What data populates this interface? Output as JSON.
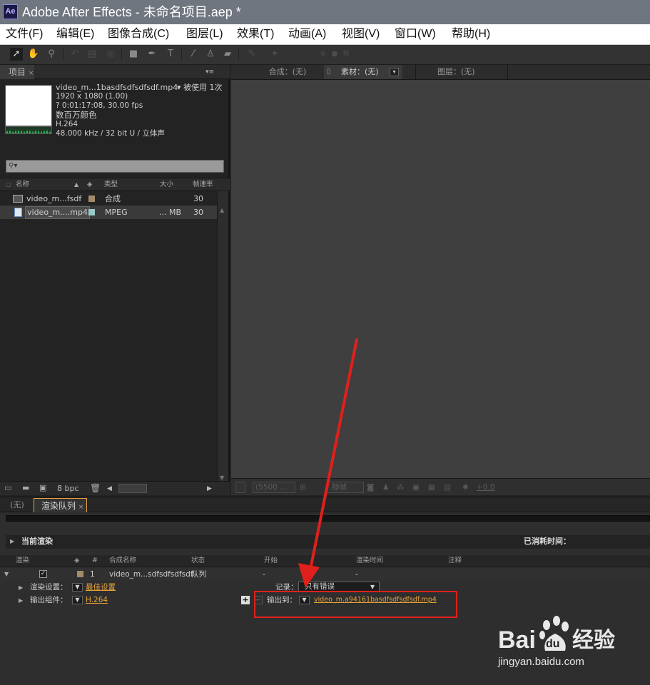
{
  "app": {
    "logo_text": "Ae",
    "title": "Adobe After Effects - 未命名项目.aep *"
  },
  "menu": [
    "文件(F)",
    "编辑(E)",
    "图像合成(C)",
    "图层(L)",
    "效果(T)",
    "动画(A)",
    "视图(V)",
    "窗口(W)",
    "帮助(H)"
  ],
  "toolbar": {
    "tools": [
      "selection-tool",
      "hand-tool",
      "zoom-tool",
      "rotate-tool",
      "camera-tool",
      "pan-behind-tool",
      "shape-tool",
      "pen-tool",
      "text-tool",
      "brush-tool",
      "clone-stamp-tool",
      "eraser-tool",
      "roto-brush-tool",
      "puppet-pin-tool"
    ]
  },
  "project": {
    "tab_label": "项目",
    "tab_close": "×",
    "menu_glyph": "▾≡",
    "asset": {
      "name": "video_m...1basdfsdfsdfsdf.mp4",
      "used": "▾  被使用 1次",
      "resolution": "1920 x 1080 (1.00)",
      "duration": "? 0:01:17:08, 30.00 fps",
      "color": "数百万颜色",
      "codec": "H.264",
      "audio": "48.000 kHz / 32 bit U / 立体声"
    },
    "search_icon": "⚲▾",
    "columns": {
      "name": "名称",
      "type": "类型",
      "size": "大小",
      "framerate": "帧速率"
    },
    "items": [
      {
        "name": "video_m...fsdf",
        "type": "合成",
        "size": "",
        "fps": "30",
        "swatch": "#a38a6a"
      },
      {
        "name": "video_m....mp4",
        "type": "MPEG",
        "size": "... MB",
        "fps": "30",
        "swatch": "#99c8c8"
      }
    ],
    "footer": {
      "bpc": "8 bpc"
    }
  },
  "viewer": {
    "tabs": {
      "comp": "合成：(无)",
      "footage": "素材：(无)",
      "layer": "图层：(无)"
    },
    "footer": {
      "zoom": "(5500 ...",
      "still": "静帧",
      "exposure": "+0.0"
    },
    "background": "#3f3f3f"
  },
  "render_queue": {
    "tab_none": "(无)",
    "tab_label": "渲染队列",
    "tab_close": "×",
    "current_render": "当前渲染",
    "elapsed": "已消耗时间：",
    "columns": {
      "render": "渲染",
      "num": "#",
      "comp_name": "合成名称",
      "status": "状态",
      "start": "开始",
      "render_time": "渲染时间",
      "comment": "注释"
    },
    "item": {
      "num": "1",
      "comp_name": "video_m...sdfsdfsdfsdf",
      "status": "队列",
      "start": "-",
      "render_time": "-"
    },
    "render_settings_label": "渲染设置：",
    "render_settings_value": "最佳设置",
    "log_label": "记录：",
    "log_value": "只有错误",
    "output_module_label": "输出组件：",
    "output_module_value": "H.264",
    "output_to_label": "输出到：",
    "output_to_value": "video_m.a94161basdfsdfsdfsdf.mp4",
    "highlight_color": "#e0201c"
  },
  "watermark": {
    "brand": "Bai",
    "paw": "du",
    "product": "经验",
    "url": "jingyan.baidu.com"
  }
}
